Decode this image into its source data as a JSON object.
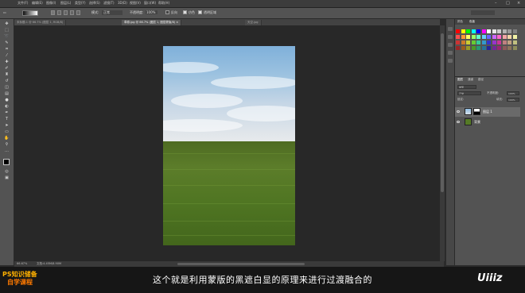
{
  "menubar": {
    "items": [
      "文件(F)",
      "编辑(E)",
      "图像(I)",
      "图层(L)",
      "类型(Y)",
      "选择(S)",
      "滤镜(T)",
      "3D(D)",
      "视图(V)",
      "窗口(W)",
      "帮助(H)"
    ],
    "min": "–",
    "max": "□",
    "close": "×"
  },
  "options": {
    "mode_label": "模式:",
    "mode_value": "正常",
    "opacity_label": "不透明度:",
    "opacity_value": "100%",
    "reverse_label": "反向",
    "dither_label": "仿色",
    "transparency_label": "透明区域"
  },
  "tabs": [
    {
      "label": "未标题-1 @ 66.7% (图层 1, RGB/8)"
    },
    {
      "label": "草原.jpg @ 66.7% (图层 1, 图层蒙版/8) ×"
    },
    {
      "label": "天空.jpg"
    }
  ],
  "status": {
    "zoom": "66.67%",
    "doc": "文档:4.45M/8.90M"
  },
  "panels": {
    "tab_color": "颜色",
    "tab_swatches": "色板",
    "tab_layers": "图层",
    "tab_channels": "通道",
    "tab_paths": "路径",
    "kind_label": "类型",
    "blend_mode": "正常",
    "opacity_label": "不透明度:",
    "opacity_value": "100%",
    "lock_label": "锁定:",
    "fill_label": "填充:",
    "fill_value": "100%",
    "layers": [
      {
        "name": "图层 1"
      },
      {
        "name": "背景"
      }
    ]
  },
  "swatch_colors": [
    "#ff0000",
    "#ffff00",
    "#00ff00",
    "#00ffff",
    "#0000ff",
    "#ff00ff",
    "#ffffff",
    "#e6e6e6",
    "#cccccc",
    "#b3b3b3",
    "#999999",
    "#808080",
    "#ff4d4d",
    "#ff9933",
    "#ffff66",
    "#99ff66",
    "#66ffcc",
    "#66ccff",
    "#6666ff",
    "#cc66ff",
    "#ff66cc",
    "#f2a6a6",
    "#f2d3a6",
    "#f2f2a6",
    "#cc3333",
    "#cc7a29",
    "#cccc33",
    "#66cc33",
    "#33cc99",
    "#3399cc",
    "#3333cc",
    "#9933cc",
    "#cc3399",
    "#c08080",
    "#c0a080",
    "#c0c080",
    "#992626",
    "#995c1f",
    "#999926",
    "#4d9926",
    "#269973",
    "#267399",
    "#262699",
    "#732699",
    "#992673",
    "#8c5a5a",
    "#8c735a",
    "#8c8c5a"
  ],
  "subtitle": "这个就是利用蒙版的黑遮白显的原理来进行过渡融合的",
  "logo_left": {
    "line1": "PS知识储备",
    "line2": "自学课程"
  },
  "logo_right": "Uiiiz"
}
